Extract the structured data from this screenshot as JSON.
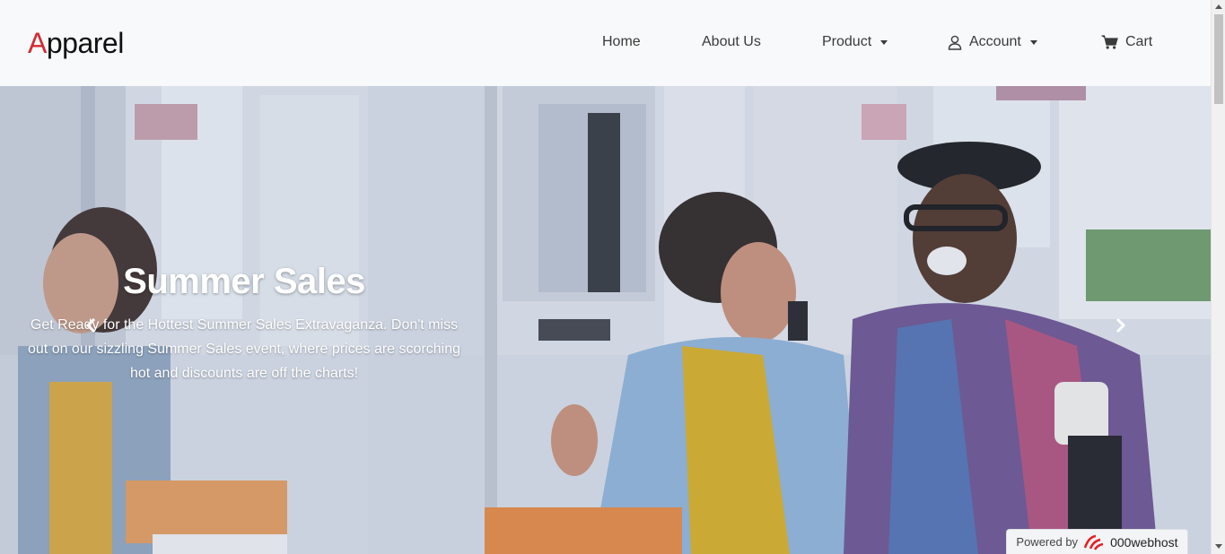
{
  "navbar": {
    "brand_first_letter": "A",
    "brand_rest": "pparel",
    "brand_accent_color": "#d42a35",
    "items": [
      {
        "label": "Home",
        "icon": ""
      },
      {
        "label": "About Us",
        "icon": ""
      },
      {
        "label": "Product",
        "icon": "chevron-down-icon"
      },
      {
        "label": "Account",
        "icon": "user-icon"
      },
      {
        "label": "Cart",
        "icon": "cart-icon"
      }
    ]
  },
  "hero": {
    "title": "Summer Sales",
    "description": "Get Ready for the Hottest Summer Sales Extravaganza. Don't miss out on our sizzling Summer Sales event, where prices are scorching hot and discounts are off the charts!",
    "prev_icon": "chevron-left-icon",
    "next_icon": "chevron-right-icon"
  },
  "footer_badge": {
    "prefix": "Powered by",
    "name": "000webhost",
    "logo_color": "#e31e24"
  }
}
